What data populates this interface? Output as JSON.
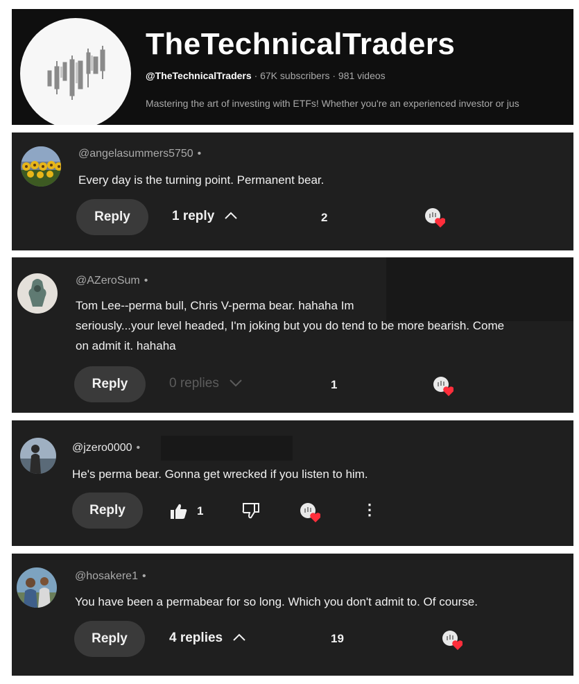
{
  "channel": {
    "name": "TheTechnicalTraders",
    "handle": "@TheTechnicalTraders",
    "meta": "· 67K subscribers · 981 videos",
    "description": "Mastering the art of investing with ETFs! Whether you're an experienced investor or jus"
  },
  "comments": [
    {
      "author": "@angelasummers5750",
      "dot": "•",
      "text": "Every day is the turning point. Permanent bear.",
      "reply_label": "Reply",
      "replies_label": "1 reply",
      "count": "2"
    },
    {
      "author": "@AZeroSum",
      "dot": "•",
      "text_line1": "Tom Lee--perma bull, Chris V-perma bear. hahaha Im",
      "text_line2": "seriously...your level headed, I'm joking but you do tend to be more bearish. Come",
      "text_line3": "on admit it. hahaha",
      "reply_label": "Reply",
      "replies_label": "0 replies",
      "count": "1"
    },
    {
      "author": "@jzero0000",
      "dot": "•",
      "text": "He's perma bear. Gonna get wrecked if you listen to him.",
      "reply_label": "Reply",
      "like_count": "1",
      "more_icon": "⋮"
    },
    {
      "author": "@hosakere1",
      "dot": "•",
      "text": "You have been a permabear for so long. Which you don't admit to. Of course.",
      "reply_label": "Reply",
      "replies_label": "4 replies",
      "count": "19"
    }
  ],
  "icons": {
    "heart": "creator-heart-icon",
    "chevron_up": "chevron-up-icon",
    "chevron_down": "chevron-down-icon",
    "like": "thumbs-up-icon",
    "dislike": "thumbs-down-icon"
  },
  "colors": {
    "panel_bg": "#1f1f1f",
    "header_bg": "#0f0f0f",
    "heart_red": "#ff2e3b",
    "muted_text": "#aaaaaa"
  }
}
